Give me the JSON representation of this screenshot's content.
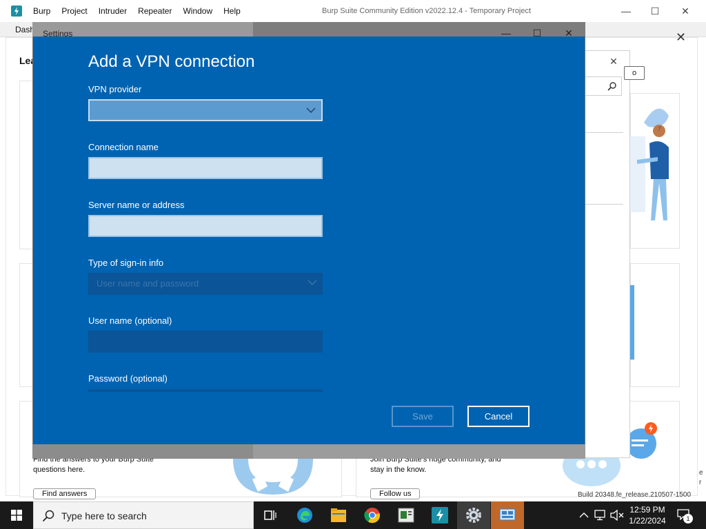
{
  "burp": {
    "menu": [
      "Burp",
      "Project",
      "Intruder",
      "Repeater",
      "Window",
      "Help"
    ],
    "title": "Burp Suite Community Edition v2022.12.4 - Temporary Project",
    "tab_dashboard": "Dash",
    "section_heading": "Lea",
    "card_left_text": "Find the answers to your Burp Suite\nquestions here.",
    "card_left_button": "Find answers",
    "card_right_text": "Join Burp Suite's huge community, and\nstay in the know.",
    "card_right_button": "Follow us",
    "popup_button_label": "o",
    "build_text": "Build 20348.fe_release.210507-1500",
    "right_edge_text": "e\nr"
  },
  "settings": {
    "title": "Settings"
  },
  "vpn": {
    "heading": "Add a VPN connection",
    "provider_label": "VPN provider",
    "provider_value": "",
    "connection_name_label": "Connection name",
    "connection_name_value": "",
    "server_label": "Server name or address",
    "server_value": "",
    "signin_type_label": "Type of sign-in info",
    "signin_type_value": "User name and password",
    "username_label": "User name (optional)",
    "username_value": "",
    "password_label": "Password (optional)",
    "save_label": "Save",
    "cancel_label": "Cancel"
  },
  "taskbar": {
    "search_placeholder": "Type here to search",
    "time": "12:59 PM",
    "date": "1/22/2024",
    "notification_count": "1"
  },
  "colors": {
    "dialog_bg": "#0063b1",
    "burp_accent": "#1a8fa6",
    "taskbar_bg": "#1a1a1a"
  }
}
